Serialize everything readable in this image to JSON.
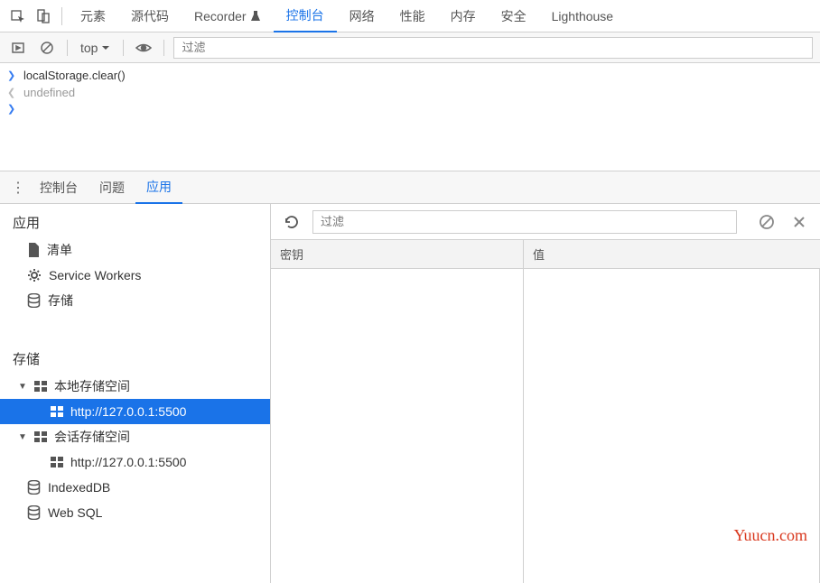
{
  "topTabs": {
    "elements": "元素",
    "sources": "源代码",
    "recorder": "Recorder",
    "console": "控制台",
    "network": "网络",
    "performance": "性能",
    "memory": "内存",
    "security": "安全",
    "lighthouse": "Lighthouse"
  },
  "consoleToolbar": {
    "context": "top",
    "filterPlaceholder": "过滤"
  },
  "consoleLines": {
    "input": "localStorage.clear()",
    "output": "undefined"
  },
  "drawerTabs": {
    "console": "控制台",
    "issues": "问题",
    "application": "应用"
  },
  "sidebar": {
    "appSection": "应用",
    "manifest": "清单",
    "serviceWorkers": "Service Workers",
    "storage": "存储",
    "storageSection": "存储",
    "localStorage": "本地存储空间",
    "localStorageOrigin": "http://127.0.0.1:5500",
    "sessionStorage": "会话存储空间",
    "sessionStorageOrigin": "http://127.0.0.1:5500",
    "indexeddb": "IndexedDB",
    "websql": "Web SQL"
  },
  "mainPanel": {
    "filterPlaceholder": "过滤",
    "keyHeader": "密钥",
    "valueHeader": "值"
  },
  "watermark": "Yuucn.com"
}
